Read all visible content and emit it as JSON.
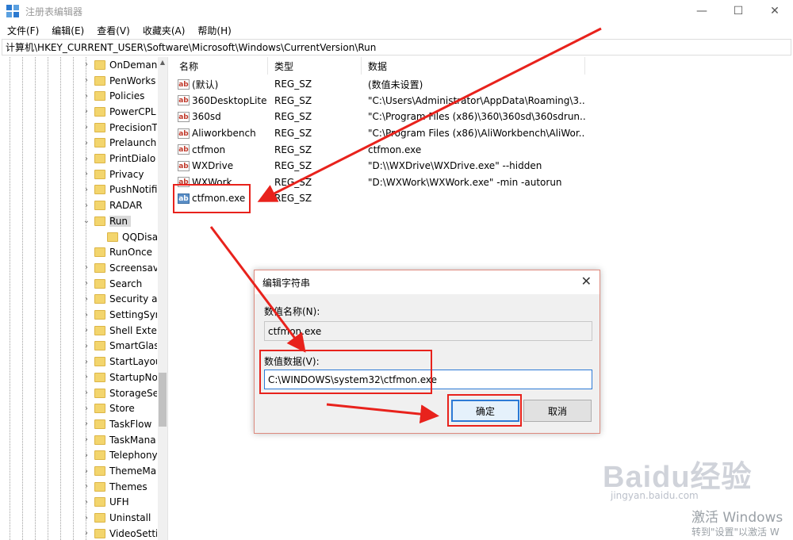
{
  "window": {
    "title": "注册表编辑器",
    "minimize": "—",
    "maximize": "☐",
    "close": "✕"
  },
  "menu": [
    "文件(F)",
    "编辑(E)",
    "查看(V)",
    "收藏夹(A)",
    "帮助(H)"
  ],
  "address": "计算机\\HKEY_CURRENT_USER\\Software\\Microsoft\\Windows\\CurrentVersion\\Run",
  "tree": {
    "items": [
      {
        "label": "OnDeman",
        "expandable": true
      },
      {
        "label": "PenWorks",
        "expandable": true
      },
      {
        "label": "Policies",
        "expandable": true
      },
      {
        "label": "PowerCPL",
        "expandable": true
      },
      {
        "label": "PrecisionT",
        "expandable": true
      },
      {
        "label": "Prelaunch",
        "expandable": true
      },
      {
        "label": "PrintDialo",
        "expandable": true
      },
      {
        "label": "Privacy",
        "expandable": true
      },
      {
        "label": "PushNotifi",
        "expandable": true
      },
      {
        "label": "RADAR",
        "expandable": true
      },
      {
        "label": "Run",
        "expandable": true,
        "expanded": true,
        "selected": true
      },
      {
        "label": "QQDisa",
        "expandable": false,
        "child": true
      },
      {
        "label": "RunOnce",
        "expandable": false
      },
      {
        "label": "Screensav",
        "expandable": true
      },
      {
        "label": "Search",
        "expandable": true
      },
      {
        "label": "Security ar",
        "expandable": true
      },
      {
        "label": "SettingSyn",
        "expandable": true
      },
      {
        "label": "Shell Exter",
        "expandable": true
      },
      {
        "label": "SmartGlas",
        "expandable": true
      },
      {
        "label": "StartLayou",
        "expandable": true
      },
      {
        "label": "StartupNo",
        "expandable": true
      },
      {
        "label": "StorageSe",
        "expandable": true
      },
      {
        "label": "Store",
        "expandable": true
      },
      {
        "label": "TaskFlow",
        "expandable": true
      },
      {
        "label": "TaskMana",
        "expandable": true
      },
      {
        "label": "Telephony",
        "expandable": true
      },
      {
        "label": "ThemeMa",
        "expandable": true
      },
      {
        "label": "Themes",
        "expandable": true
      },
      {
        "label": "UFH",
        "expandable": true
      },
      {
        "label": "Uninstall",
        "expandable": true
      },
      {
        "label": "VideoSetti",
        "expandable": true
      }
    ]
  },
  "list": {
    "headers": [
      "名称",
      "类型",
      "数据"
    ],
    "rows": [
      {
        "icon": "ab",
        "kind": "str",
        "name": "(默认)",
        "type": "REG_SZ",
        "data": "(数值未设置)"
      },
      {
        "icon": "ab",
        "kind": "str",
        "name": "360DesktopLite",
        "type": "REG_SZ",
        "data": "\"C:\\Users\\Administrator\\AppData\\Roaming\\3..."
      },
      {
        "icon": "ab",
        "kind": "str",
        "name": "360sd",
        "type": "REG_SZ",
        "data": "\"C:\\Program Files (x86)\\360\\360sd\\360sdrun...."
      },
      {
        "icon": "ab",
        "kind": "str",
        "name": "Aliworkbench",
        "type": "REG_SZ",
        "data": "\"C:\\Program Files (x86)\\AliWorkbench\\AliWor..."
      },
      {
        "icon": "ab",
        "kind": "str",
        "name": "ctfmon",
        "type": "REG_SZ",
        "data": "ctfmon.exe"
      },
      {
        "icon": "ab",
        "kind": "str",
        "name": "WXDrive",
        "type": "REG_SZ",
        "data": "\"D:\\\\WXDrive\\WXDrive.exe\" --hidden"
      },
      {
        "icon": "ab",
        "kind": "str",
        "name": "WXWork",
        "type": "REG_SZ",
        "data": "\"D:\\WXWork\\WXWork.exe\" -min -autorun"
      },
      {
        "icon": "ab",
        "kind": "exe",
        "name": "ctfmon.exe",
        "type": "REG_SZ",
        "data": ""
      }
    ]
  },
  "dialog": {
    "title": "编辑字符串",
    "close": "✕",
    "name_label": "数值名称(N):",
    "name_value": "ctfmon.exe",
    "data_label": "数值数据(V):",
    "data_value": "C:\\WINDOWS\\system32\\ctfmon.exe",
    "ok": "确定",
    "cancel": "取消"
  },
  "annotation_color": "#e8221c",
  "watermark": {
    "brand": "Baidu经验",
    "url": "jingyan.baidu.com"
  },
  "activation": {
    "line1": "激活 Windows",
    "line2": "转到\"设置\"以激活 W"
  }
}
